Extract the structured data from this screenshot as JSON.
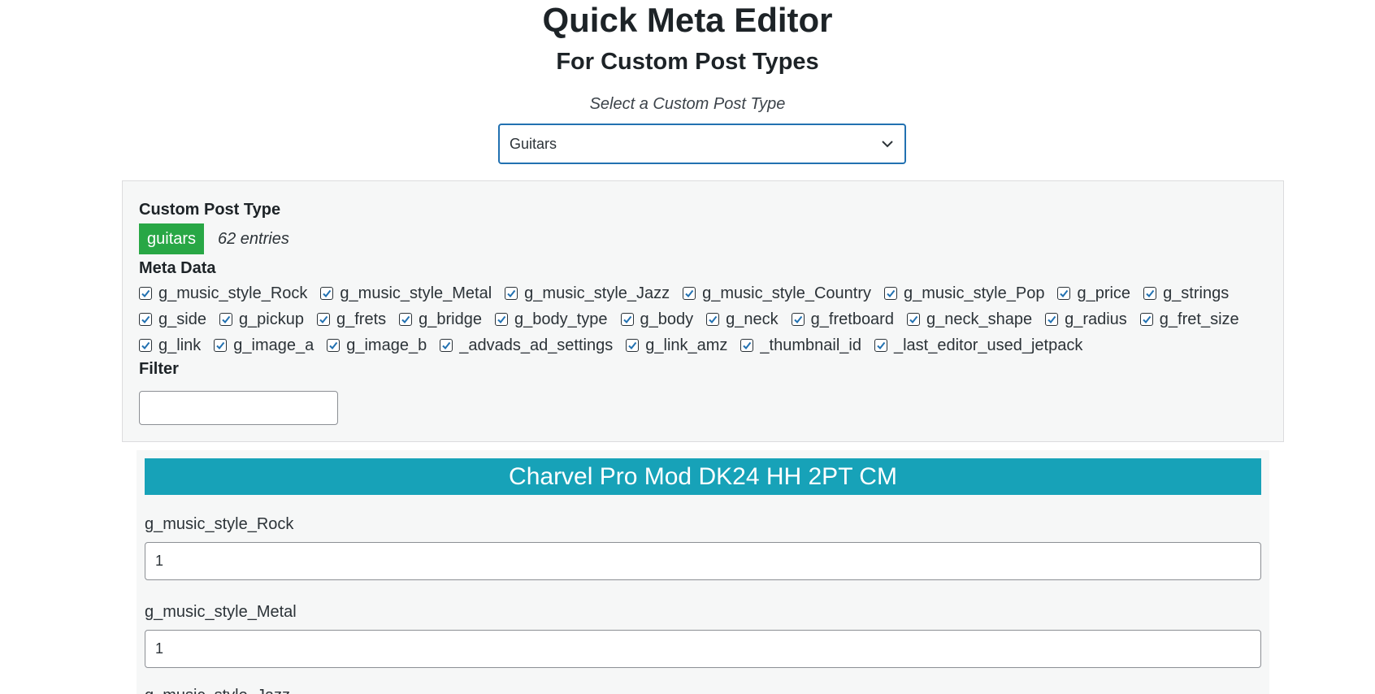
{
  "header": {
    "title": "Quick Meta Editor",
    "subtitle": "For Custom Post Types",
    "select_label": "Select a Custom Post Type"
  },
  "post_type_select": {
    "selected": "Guitars"
  },
  "panel": {
    "cpt_heading": "Custom Post Type",
    "cpt_badge": "guitars",
    "entries": "62 entries",
    "meta_heading": "Meta Data",
    "filter_heading": "Filter",
    "filter_value": "",
    "meta_rows": [
      [
        "g_music_style_Rock",
        "g_music_style_Metal",
        "g_music_style_Jazz",
        "g_music_style_Country",
        "g_music_style_Pop",
        "g_price",
        "g_strings"
      ],
      [
        "g_side",
        "g_pickup",
        "g_frets",
        "g_bridge",
        "g_body_type",
        "g_body",
        "g_neck",
        "g_fretboard",
        "g_neck_shape",
        "g_radius",
        "g_fret_size"
      ],
      [
        "g_link",
        "g_image_a",
        "g_image_b",
        "_advads_ad_settings",
        "g_link_amz",
        "_thumbnail_id",
        "_last_editor_used_jetpack"
      ]
    ]
  },
  "post": {
    "title": "Charvel Pro Mod DK24 HH 2PT CM",
    "fields": [
      {
        "label": "g_music_style_Rock",
        "value": "1"
      },
      {
        "label": "g_music_style_Metal",
        "value": "1"
      },
      {
        "label": "g_music_style_Jazz",
        "value": ""
      }
    ]
  },
  "colors": {
    "accent": "#2271b1",
    "badge": "#28a745",
    "post_header": "#17a2b8"
  }
}
